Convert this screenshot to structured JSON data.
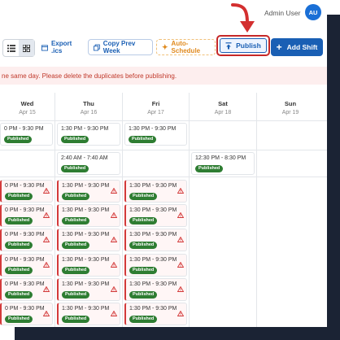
{
  "header": {
    "user_name": "Admin User",
    "avatar_initials": "AU"
  },
  "toolbar": {
    "export_label": "Export .ics",
    "copy_prev_label": "Copy Prev Week",
    "auto_schedule_label": "Auto-Schedule",
    "publish_label": "Publish",
    "add_shift_label": "Add Shift"
  },
  "warning": {
    "text": "ne same day. Please delete the duplicates before publishing."
  },
  "days": [
    {
      "day": "Wed",
      "date": "Apr 15"
    },
    {
      "day": "Thu",
      "date": "Apr 16"
    },
    {
      "day": "Fri",
      "date": "Apr 17"
    },
    {
      "day": "Sat",
      "date": "Apr 18"
    },
    {
      "day": "Sun",
      "date": "Apr 19"
    }
  ],
  "status_label": "Published",
  "shifts": {
    "r1_wed": "0 PM - 9:30 PM",
    "r1_thu": "1:30 PM - 9:30 PM",
    "r1_fri": "1:30 PM - 9:30 PM",
    "r2_thu": "2:40 AM - 7:40 AM",
    "r2_sat": "12:30 PM - 8:30 PM",
    "conflict": "1:30 PM - 9:30 PM",
    "conflict_wed": "0 PM - 9:30 PM"
  },
  "colors": {
    "accent": "#1a5fb4",
    "published": "#2e7d32",
    "conflict": "#d33a3a",
    "highlight": "#c62828"
  }
}
